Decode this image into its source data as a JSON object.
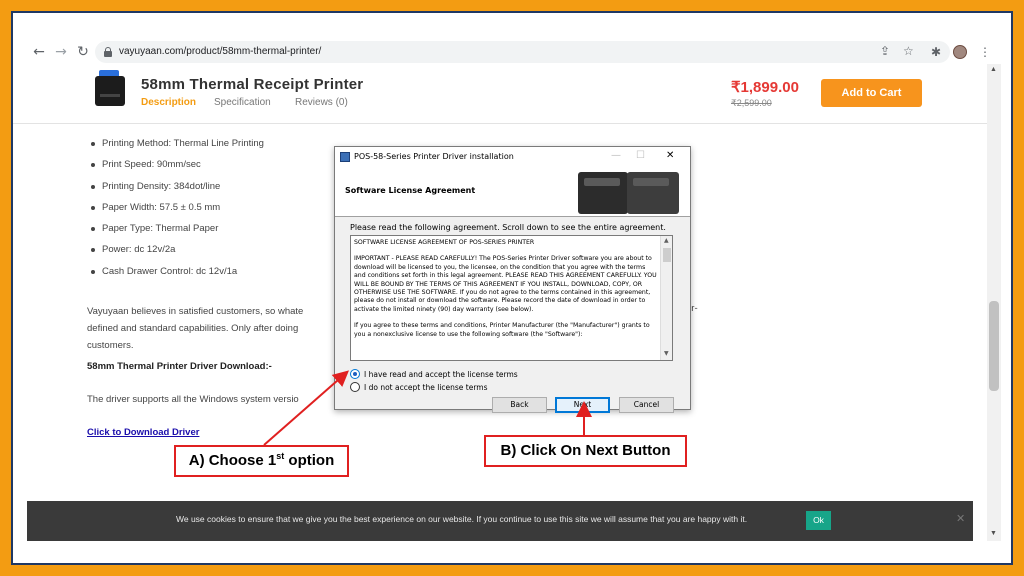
{
  "browser": {
    "url": "vayuyaan.com/product/58mm-thermal-printer/",
    "icons": [
      "back-icon",
      "forward-icon",
      "reload-icon",
      "lock-icon",
      "share-icon",
      "star-icon",
      "extensions-icon",
      "profile-avatar",
      "menu-icon"
    ]
  },
  "product": {
    "title": "58mm Thermal Receipt Printer",
    "tabs": [
      "Description",
      "Specification",
      "Reviews (0)"
    ],
    "price": "₹1,899.00",
    "old_price": "₹2,599.00",
    "add_to_cart": "Add to Cart"
  },
  "specs": [
    "Printing Method: Thermal Line Printing",
    "Print Speed: 90mm/sec",
    "Printing Density: 384dot/line",
    "Paper Width: 57.5 ± 0.5 mm",
    "Paper Type: Thermal Paper",
    "Power: dc 12v/2a",
    "Cash Drawer Control: dc 12v/1a"
  ],
  "content": {
    "para_start": "Vayuyaan believes in satisfied customers, so whate",
    "para_tail": "er-",
    "para_line2": "defined and standard capabilities. Only after doing",
    "para_line3": "customers.",
    "download_heading": "58mm Thermal Printer Driver Download:-",
    "driver_support": "The driver supports all the Windows system versio",
    "download_link": "Click to Download Driver"
  },
  "cookie": {
    "text": "We use cookies to ensure that we give you the best experience on our website. If you continue to use this site we will assume that you are happy with it.",
    "ok": "Ok",
    "close": "✕"
  },
  "dialog": {
    "title": "POS-58-Series Printer Driver installation",
    "banner_title": "Software License Agreement",
    "instruction": "Please read the following agreement. Scroll down to see the entire agreement.",
    "license_paragraphs": [
      "SOFTWARE LICENSE AGREEMENT OF POS-SERIES PRINTER",
      "IMPORTANT - PLEASE READ CAREFULLY!  The POS-Series Printer Driver software you are about to download will be licensed to you, the licensee, on the condition that you agree with the terms and conditions set forth in this legal agreement.  PLEASE READ THIS AGREEMENT CAREFULLY.  YOU WILL BE BOUND BY THE TERMS OF THIS AGREEMENT IF YOU INSTALL, DOWNLOAD, COPY, OR OTHERWISE USE THE SOFTWARE.  If you do not agree to the terms contained in this agreement, please do not install or download the software.  Please record the date of download in order to activate the limited ninety (90) day warranty (see below).",
      "If you agree to these terms and conditions, Printer Manufacturer (the \"Manufacturer\") grants to you a nonexclusive license to use the following software (the \"Software\"):"
    ],
    "radio_accept": "I have read and accept the license terms",
    "radio_decline": "I do not accept the license terms",
    "accept_selected": true,
    "btn_back": "Back",
    "btn_next": "Next",
    "btn_cancel": "Cancel"
  },
  "annotations": {
    "callout_a_prefix": "A) Choose 1",
    "callout_a_sup": "st",
    "callout_a_suffix": " option",
    "callout_b": "B) Click On Next Button",
    "arrow_color": "#e02020"
  }
}
